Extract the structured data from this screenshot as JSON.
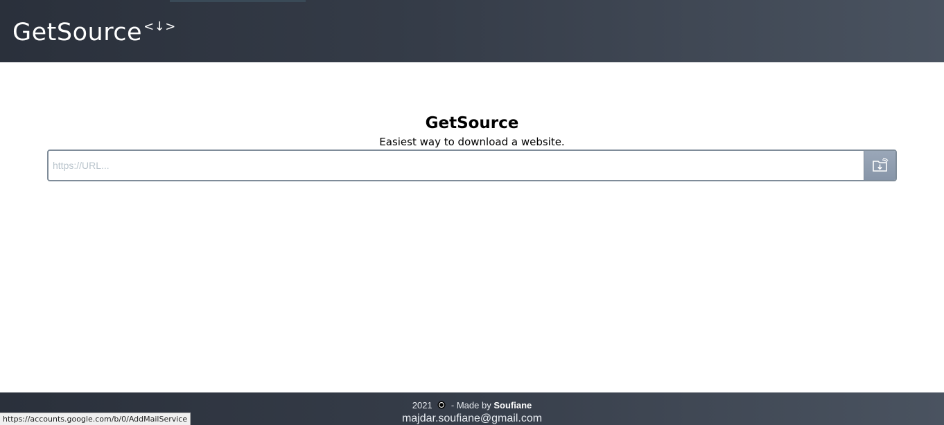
{
  "header": {
    "brand": "GetSource",
    "brand_badge": "<↓>",
    "background_color": "#2a303b"
  },
  "hero": {
    "title": "GetSource",
    "subtitle": "Easiest way to download a website."
  },
  "search": {
    "placeholder": "https://URL...",
    "value": "",
    "button_icon": "folder-download-icon",
    "button_color": "#9aa7b8"
  },
  "footer": {
    "year": "2021",
    "copyright_icon": "copyright-icon",
    "made_by_prefix": "- Made by",
    "author": "Soufiane",
    "email": "majdar.soufiane@gmail.com"
  },
  "status_bar": {
    "url": "https://accounts.google.com/b/0/AddMailService"
  }
}
